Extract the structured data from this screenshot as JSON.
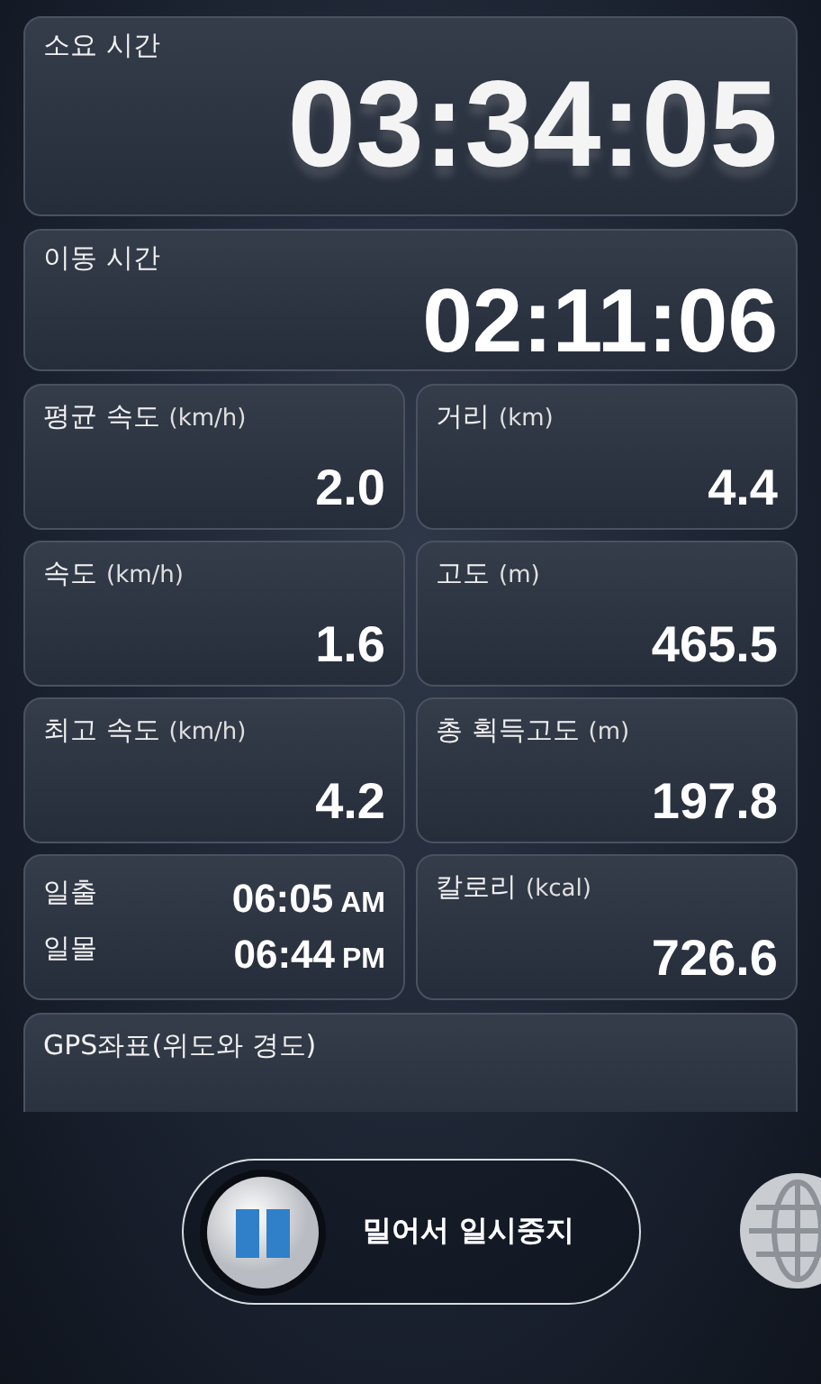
{
  "elapsed": {
    "label": "소요 시간",
    "value": "03:34:05"
  },
  "moving": {
    "label": "이동 시간",
    "value": "02:11:06"
  },
  "stats": [
    {
      "kind": "stat",
      "label": "평균 속도",
      "unit": "(km/h)",
      "value": "2.0"
    },
    {
      "kind": "stat",
      "label": "거리",
      "unit": "(km)",
      "value": "4.4"
    },
    {
      "kind": "stat",
      "label": "속도",
      "unit": "(km/h)",
      "value": "1.6"
    },
    {
      "kind": "stat",
      "label": "고도",
      "unit": "(m)",
      "value": "465.5"
    },
    {
      "kind": "stat",
      "label": "최고 속도",
      "unit": "(km/h)",
      "value": "4.2"
    },
    {
      "kind": "stat",
      "label": "총 획득고도",
      "unit": "(m)",
      "value": "197.8"
    },
    {
      "kind": "sun",
      "rows": [
        {
          "label": "일출",
          "time": "06:05",
          "meridiem": "AM"
        },
        {
          "label": "일몰",
          "time": "06:44",
          "meridiem": "PM"
        }
      ]
    },
    {
      "kind": "stat",
      "label": "칼로리",
      "unit": "(kcal)",
      "value": "726.6"
    }
  ],
  "gps": {
    "label": "GPS좌표(위도와 경도)"
  },
  "slider": {
    "label": "밀어서 일시중지",
    "level": 0
  }
}
